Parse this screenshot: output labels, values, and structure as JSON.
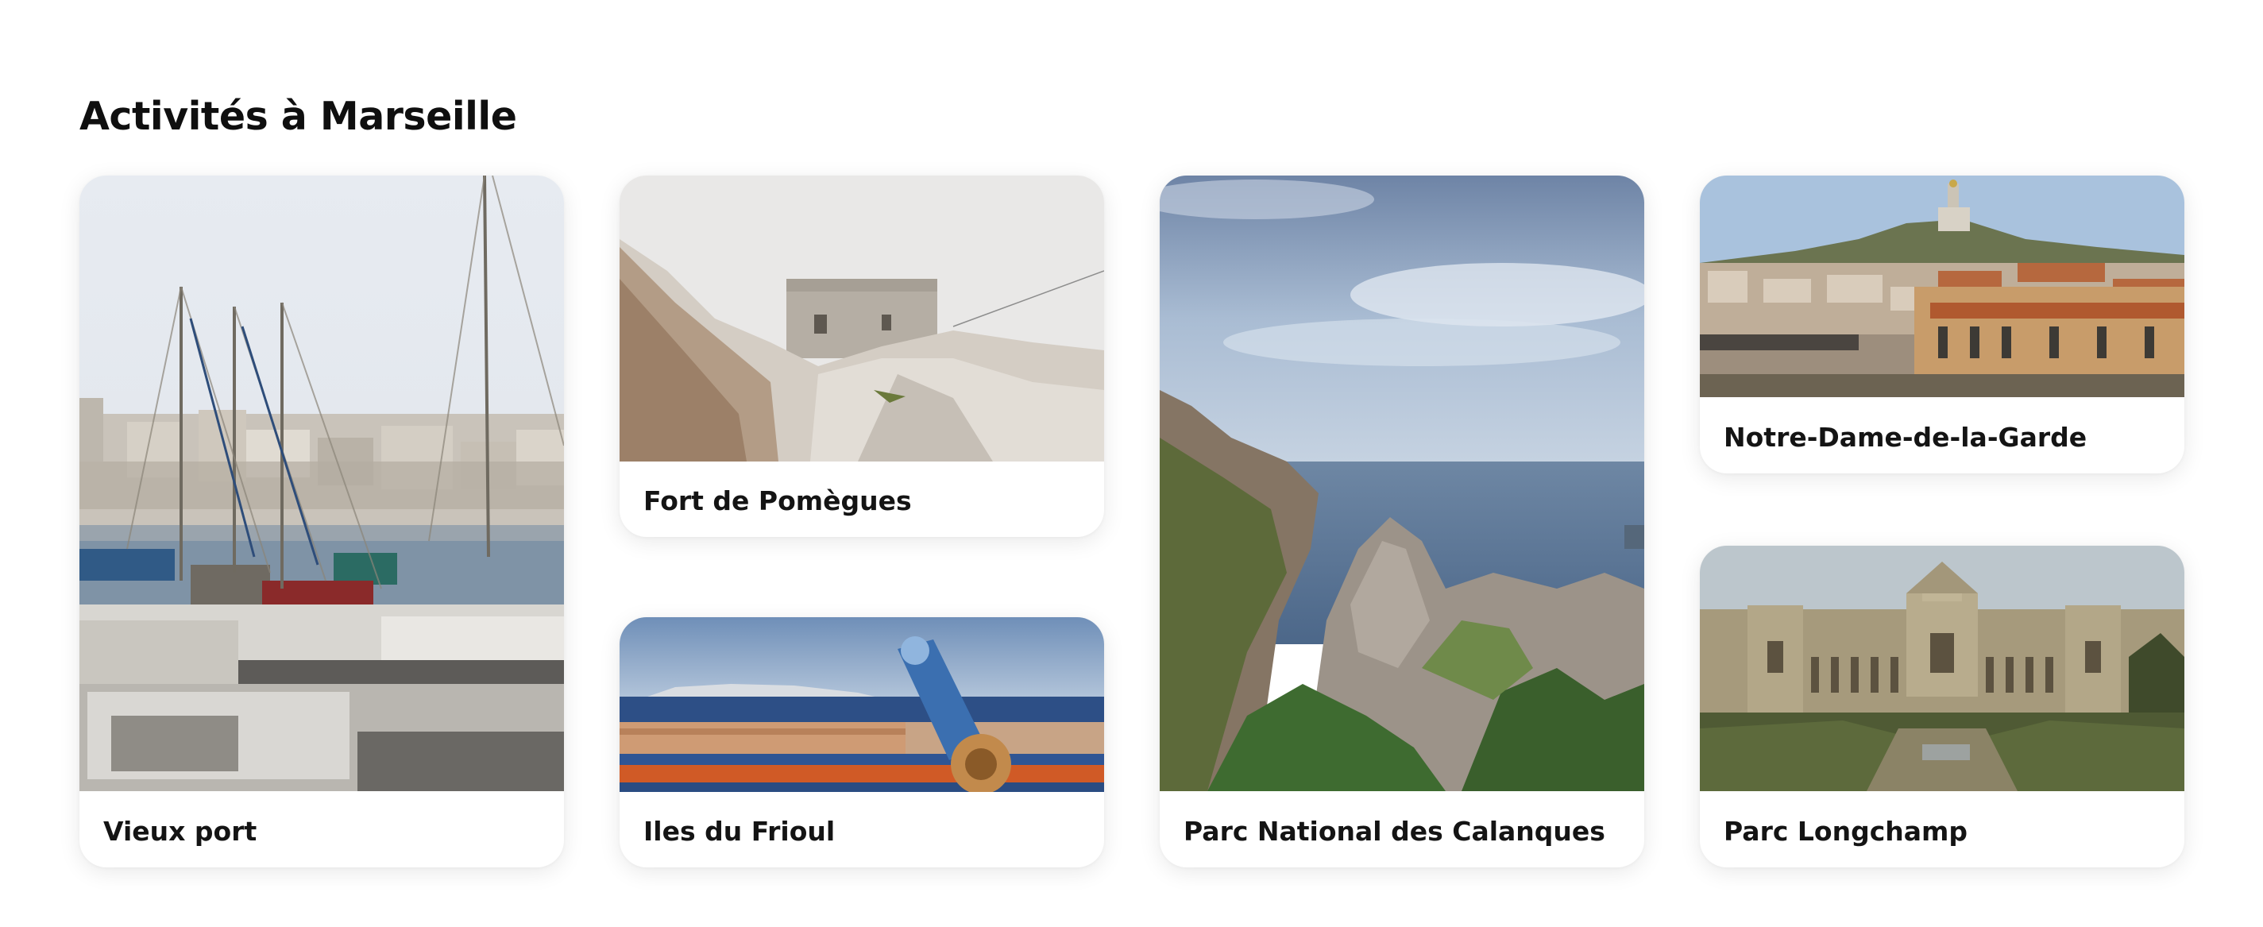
{
  "page": {
    "title": "Activités à Marseille"
  },
  "cards": [
    {
      "label": "Vieux port"
    },
    {
      "label": "Fort de Pomègues"
    },
    {
      "label": "Iles du Frioul"
    },
    {
      "label": "Parc National des Calanques"
    },
    {
      "label": "Notre-Dame-de-la-Garde"
    },
    {
      "label": "Parc Longchamp"
    }
  ],
  "colors": {
    "background": "#ffffff",
    "text": "#141414",
    "card_background": "#ffffff"
  }
}
